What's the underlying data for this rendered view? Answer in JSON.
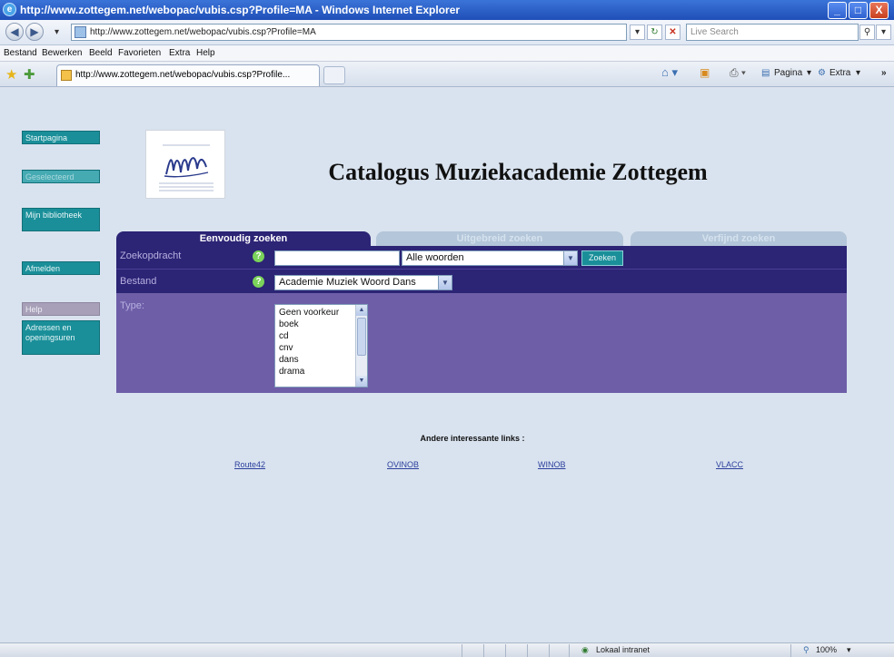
{
  "window": {
    "title": "http://www.zottegem.net/webopac/vubis.csp?Profile=MA - Windows Internet Explorer",
    "minimize": "_",
    "maximize": "□",
    "close": "X"
  },
  "addressbar": {
    "url": "http://www.zottegem.net/webopac/vubis.csp?Profile=MA",
    "search_placeholder": "Live Search"
  },
  "menu": [
    "Bestand",
    "Bewerken",
    "Beeld",
    "Favorieten",
    "Extra",
    "Help"
  ],
  "tabbar": {
    "tab_title": "http://www.zottegem.net/webopac/vubis.csp?Profile...",
    "pagina": "Pagina",
    "extra": "Extra"
  },
  "sidebar": {
    "items": [
      "Startpagina",
      "Geselecteerd",
      "Mijn bibliotheek",
      "Afmelden",
      "Help",
      "Adressen en openingsuren"
    ]
  },
  "page": {
    "heading": "Catalogus Muziekacademie Zottegem"
  },
  "tabs": [
    "Eenvoudig zoeken",
    "Uitgebreid zoeken",
    "Verfijnd zoeken"
  ],
  "form": {
    "zoekopdracht_label": "Zoekopdracht",
    "bestand_label": "Bestand",
    "type_label": "Type:",
    "help_glyph": "?",
    "mode_value": "Alle woorden",
    "search_button": "Zoeken",
    "bestand_value": "Academie Muziek Woord Dans",
    "type_options": [
      "Geen voorkeur",
      "boek",
      "cd",
      "cnv",
      "dans",
      "drama"
    ]
  },
  "links": {
    "title": "Andere interessante links :",
    "items": [
      "Route42",
      "OVINOB",
      "WINOB",
      "VLACC"
    ]
  },
  "statusbar": {
    "zone": "Lokaal intranet",
    "zoom": "100%"
  }
}
